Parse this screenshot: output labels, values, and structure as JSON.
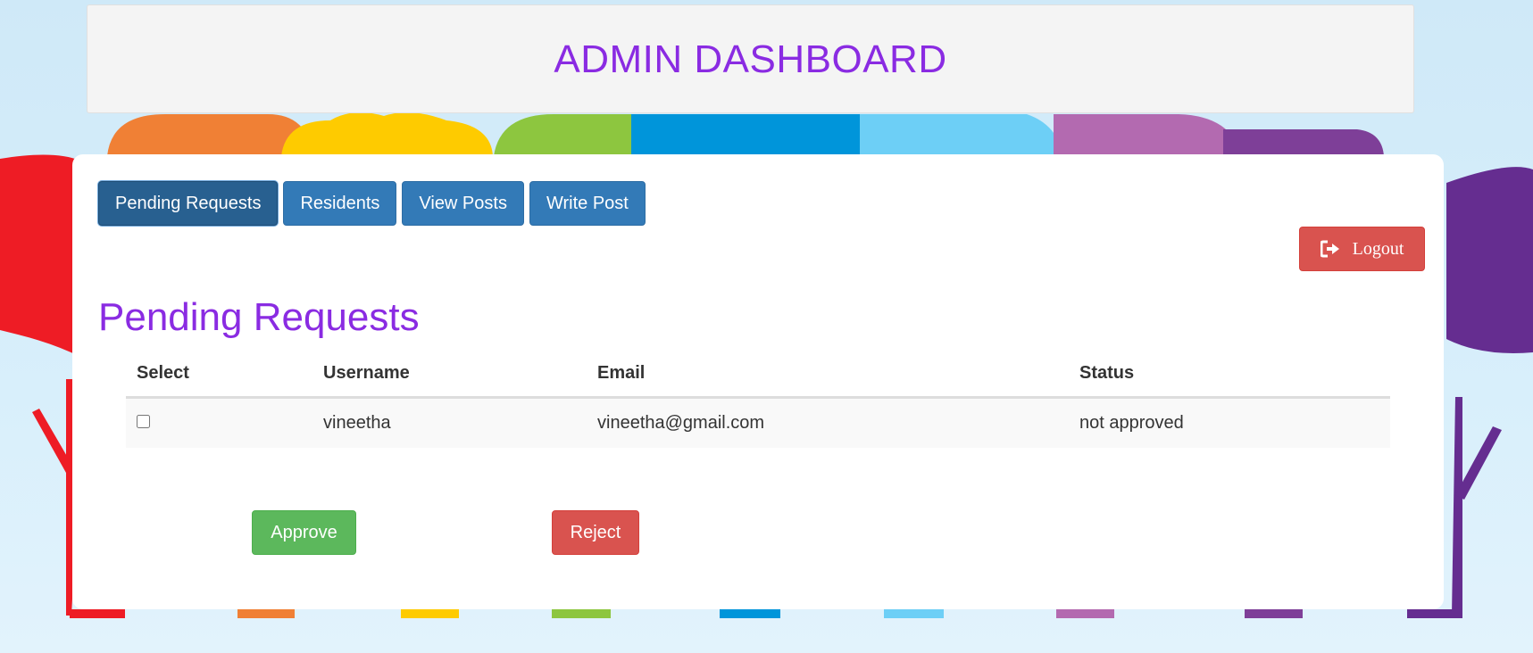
{
  "header": {
    "title": "ADMIN DASHBOARD"
  },
  "tabs": [
    {
      "label": "Pending Requests",
      "active": true
    },
    {
      "label": "Residents",
      "active": false
    },
    {
      "label": "View Posts",
      "active": false
    },
    {
      "label": "Write Post",
      "active": false
    }
  ],
  "logout": {
    "label": "Logout",
    "icon": "sign-out-icon"
  },
  "section": {
    "title": "Pending Requests"
  },
  "table": {
    "headers": [
      "Select",
      "Username",
      "Email",
      "Status"
    ],
    "rows": [
      {
        "selected": false,
        "username": "vineetha",
        "email": "vineetha@gmail.com",
        "status": "not approved"
      }
    ]
  },
  "actions": {
    "approve_label": "Approve",
    "reject_label": "Reject"
  },
  "colors": {
    "accent_purple": "#8a2be2",
    "primary_blue": "#337ab7",
    "danger_red": "#d9534f",
    "success_green": "#5cb85c"
  }
}
